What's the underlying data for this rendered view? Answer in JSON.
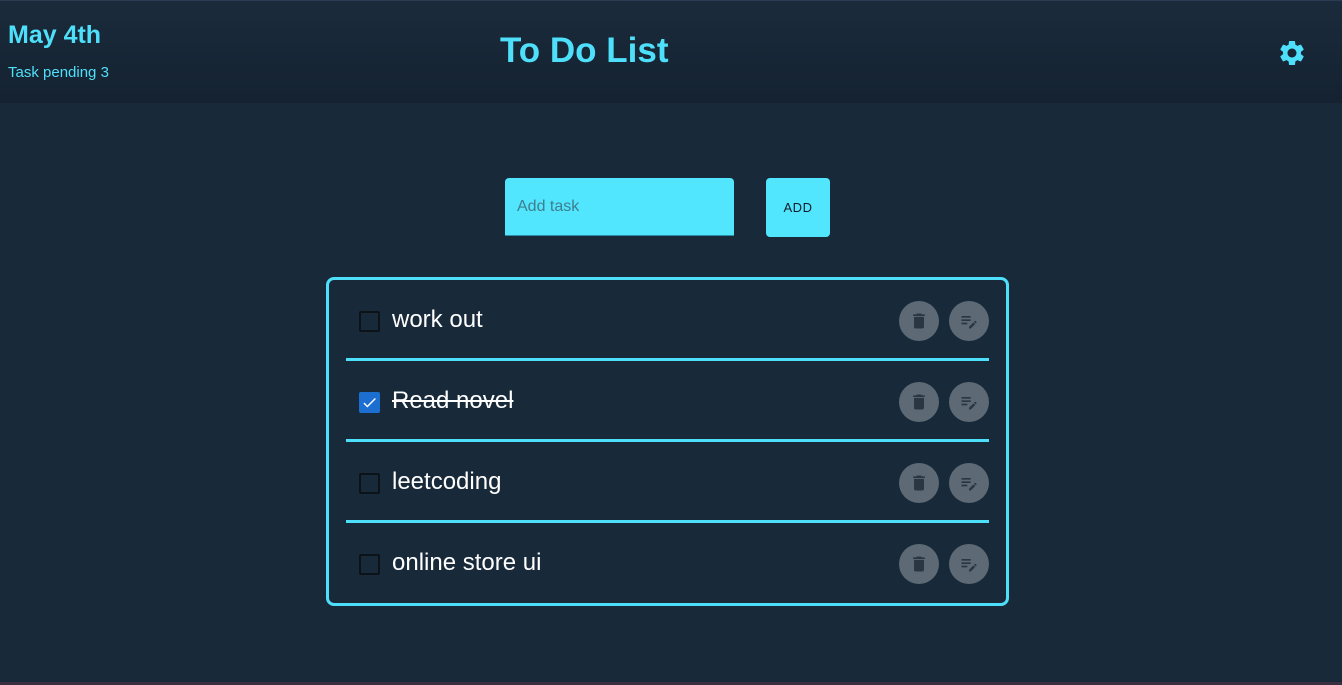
{
  "header": {
    "date": "May 4th",
    "pending_text": "Task pending 3",
    "title": "To Do List",
    "settings_icon": "gear-icon"
  },
  "add_task": {
    "placeholder": "Add task",
    "value": "",
    "button_label": "ADD"
  },
  "tasks": [
    {
      "label": "work out",
      "checked": false
    },
    {
      "label": "Read novel",
      "checked": true
    },
    {
      "label": "leetcoding",
      "checked": false
    },
    {
      "label": "online store ui",
      "checked": false
    }
  ],
  "task_actions": {
    "delete_icon": "trash-icon",
    "edit_icon": "edit-note-icon"
  },
  "colors": {
    "accent": "#4ee0fb",
    "background": "#18293a",
    "checkbox_checked": "#1c6fd1",
    "action_button": "#5d6a75"
  }
}
